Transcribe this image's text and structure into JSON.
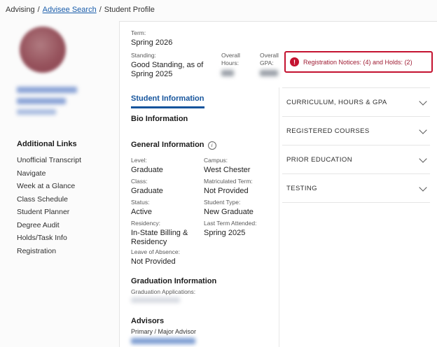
{
  "breadcrumb": {
    "items": [
      "Advising",
      "Advisee Search",
      "Student Profile"
    ],
    "separator": "/"
  },
  "sidebar": {
    "additional_links_title": "Additional Links",
    "links": [
      "Unofficial Transcript",
      "Navigate",
      "Week at a Glance",
      "Class Schedule",
      "Student Planner",
      "Degree Audit",
      "Holds/Task Info",
      "Registration"
    ]
  },
  "summary": {
    "term_label": "Term:",
    "term_value": "Spring 2026",
    "standing_label": "Standing:",
    "standing_value": "Good Standing, as of Spring 2025",
    "hours_label": "Overall Hours:",
    "gpa_label": "Overall GPA:",
    "alert_text": "Registration Notices: (4) and Holds: (2)"
  },
  "tabs": {
    "student_information": "Student Information"
  },
  "bio": {
    "bio_title": "Bio Information",
    "general_title": "General Information",
    "fields": [
      {
        "label": "Level:",
        "value": "Graduate"
      },
      {
        "label": "Campus:",
        "value": "West Chester"
      },
      {
        "label": "Class:",
        "value": "Graduate"
      },
      {
        "label": "Matriculated Term:",
        "value": "Not Provided"
      },
      {
        "label": "Status:",
        "value": "Active"
      },
      {
        "label": "Student Type:",
        "value": "New Graduate"
      },
      {
        "label": "Residency:",
        "value": "In-State Billing & Residency"
      },
      {
        "label": "Last Term Attended:",
        "value": "Spring 2025"
      },
      {
        "label": "Leave of Absence:",
        "value": "Not Provided"
      }
    ],
    "graduation_title": "Graduation Information",
    "graduation_apps_label": "Graduation Applications:",
    "advisors_title": "Advisors",
    "advisor_role": "Primary / Major Advisor"
  },
  "accordions": {
    "items": [
      "CURRICULUM, HOURS & GPA",
      "REGISTERED COURSES",
      "PRIOR EDUCATION",
      "TESTING"
    ]
  },
  "icons": {
    "alert": "!",
    "info": "i"
  },
  "colors": {
    "accent": "#15549c",
    "link": "#1a5dab",
    "alert_red": "#c41230"
  }
}
